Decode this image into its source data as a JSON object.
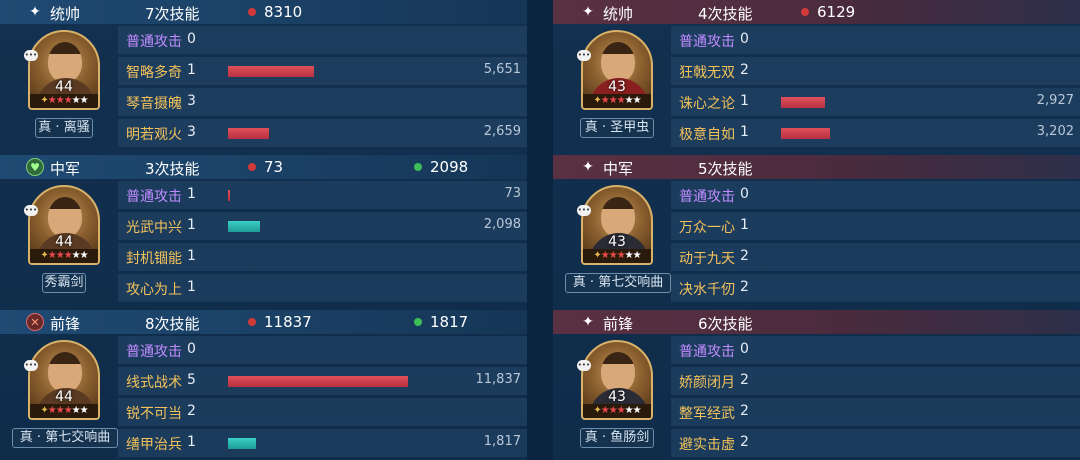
{
  "left": [
    {
      "role_icon": "✦",
      "role": "统帅",
      "skill_count": "7次技能",
      "red_stat": "8310",
      "green_stat": "",
      "hero": {
        "level": "44",
        "weapon": "真 · 离骚",
        "style": ""
      },
      "rows": [
        {
          "name": "普通攻击",
          "count": "0",
          "value": "",
          "bar_color": "",
          "bar_fraction": 0,
          "normal": true
        },
        {
          "name": "智略多奇",
          "count": "1",
          "value": "5,651",
          "bar_color": "red",
          "bar_fraction": 0.478
        },
        {
          "name": "琴音摄魄",
          "count": "3",
          "value": "",
          "bar_color": "",
          "bar_fraction": 0
        },
        {
          "name": "明若观火",
          "count": "3",
          "value": "2,659",
          "bar_color": "red",
          "bar_fraction": 0.225
        }
      ]
    },
    {
      "role_icon": "♥",
      "role_icon_name": "heart-badge-icon",
      "role": "中军",
      "skill_count": "3次技能",
      "red_stat": "73",
      "green_stat": "2098",
      "hero": {
        "level": "44",
        "weapon": "秀霸剑",
        "style": ""
      },
      "rows": [
        {
          "name": "普通攻击",
          "count": "1",
          "value": "73",
          "bar_color": "red",
          "bar_fraction": 0.006,
          "normal": true
        },
        {
          "name": "光武中兴",
          "count": "1",
          "value": "2,098",
          "bar_color": "teal",
          "bar_fraction": 0.177
        },
        {
          "name": "封机锢能",
          "count": "1",
          "value": "",
          "bar_color": "",
          "bar_fraction": 0
        },
        {
          "name": "攻心为上",
          "count": "1",
          "value": "",
          "bar_color": "",
          "bar_fraction": 0
        }
      ]
    },
    {
      "role_icon": "✕",
      "role_icon_name": "crossed-swords-icon",
      "role": "前锋",
      "skill_count": "8次技能",
      "red_stat": "11837",
      "green_stat": "1817",
      "hero": {
        "level": "44",
        "weapon": "真 · 第七交响曲",
        "style": ""
      },
      "rows": [
        {
          "name": "普通攻击",
          "count": "0",
          "value": "",
          "bar_color": "",
          "bar_fraction": 0,
          "normal": true
        },
        {
          "name": "线式战术",
          "count": "5",
          "value": "11,837",
          "bar_color": "red",
          "bar_fraction": 1.0
        },
        {
          "name": "锐不可当",
          "count": "2",
          "value": "",
          "bar_color": "",
          "bar_fraction": 0
        },
        {
          "name": "缮甲治兵",
          "count": "1",
          "value": "1,817",
          "bar_color": "teal",
          "bar_fraction": 0.154
        }
      ]
    }
  ],
  "right": [
    {
      "role_icon": "✦",
      "role": "统帅",
      "skill_count": "4次技能",
      "red_stat": "6129",
      "green_stat": "",
      "hero": {
        "level": "43",
        "weapon": "真 · 圣甲虫",
        "style": "red"
      },
      "rows": [
        {
          "name": "普通攻击",
          "count": "0",
          "value": "",
          "bar_color": "",
          "bar_fraction": 0,
          "normal": true
        },
        {
          "name": "狂戟无双",
          "count": "2",
          "value": "",
          "bar_color": "",
          "bar_fraction": 0
        },
        {
          "name": "诛心之论",
          "count": "1",
          "value": "2,927",
          "bar_color": "red",
          "bar_fraction": 0.247
        },
        {
          "name": "极意自如",
          "count": "1",
          "value": "3,202",
          "bar_color": "red",
          "bar_fraction": 0.27
        }
      ]
    },
    {
      "role_icon": "✦",
      "role": "中军",
      "skill_count": "5次技能",
      "red_stat": "",
      "green_stat": "",
      "hero": {
        "level": "43",
        "weapon": "真 · 第七交响曲",
        "style": "dark"
      },
      "rows": [
        {
          "name": "普通攻击",
          "count": "0",
          "value": "",
          "bar_color": "",
          "bar_fraction": 0,
          "normal": true
        },
        {
          "name": "万众一心",
          "count": "1",
          "value": "",
          "bar_color": "",
          "bar_fraction": 0
        },
        {
          "name": "动于九天",
          "count": "2",
          "value": "",
          "bar_color": "",
          "bar_fraction": 0
        },
        {
          "name": "决水千仞",
          "count": "2",
          "value": "",
          "bar_color": "",
          "bar_fraction": 0
        }
      ]
    },
    {
      "role_icon": "✦",
      "role": "前锋",
      "skill_count": "6次技能",
      "red_stat": "",
      "green_stat": "",
      "hero": {
        "level": "43",
        "weapon": "真 · 鱼肠剑",
        "style": "dark"
      },
      "rows": [
        {
          "name": "普通攻击",
          "count": "0",
          "value": "",
          "bar_color": "",
          "bar_fraction": 0,
          "normal": true
        },
        {
          "name": "娇颜闭月",
          "count": "2",
          "value": "",
          "bar_color": "",
          "bar_fraction": 0
        },
        {
          "name": "整军经武",
          "count": "2",
          "value": "",
          "bar_color": "",
          "bar_fraction": 0
        },
        {
          "name": "避实击虚",
          "count": "2",
          "value": "",
          "bar_color": "",
          "bar_fraction": 0
        }
      ]
    }
  ]
}
